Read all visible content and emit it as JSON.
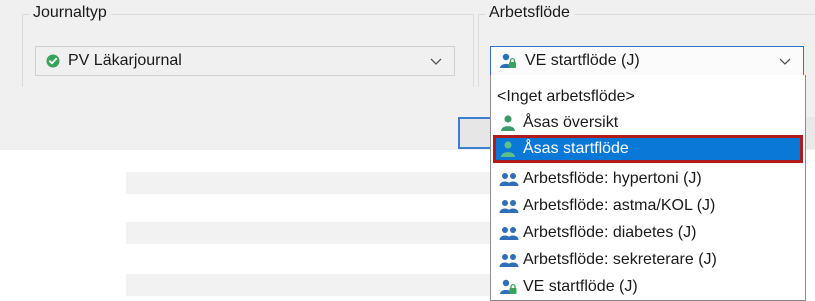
{
  "journaltyp": {
    "label": "Journaltyp",
    "value": "PV Läkarjournal",
    "icon": "check-circle-icon"
  },
  "arbetsflode": {
    "label": "Arbetsflöde",
    "value": "VE startflöde (J)",
    "icon": "user-lock-icon"
  },
  "dropdown": {
    "items": [
      {
        "label": "<Inget arbetsflöde>",
        "icon": ""
      },
      {
        "label": "Åsas översikt",
        "icon": "user-icon"
      },
      {
        "label": "Åsas startflöde",
        "icon": "user-icon",
        "selected": true
      },
      {
        "label": "Arbetsflöde: hypertoni (J)",
        "icon": "users-icon"
      },
      {
        "label": "Arbetsflöde: astma/KOL (J)",
        "icon": "users-icon"
      },
      {
        "label": "Arbetsflöde: diabetes (J)",
        "icon": "users-icon"
      },
      {
        "label": "Arbetsflöde: sekreterare (J)",
        "icon": "users-icon"
      },
      {
        "label": "VE startflöde (J)",
        "icon": "user-lock-icon"
      }
    ]
  },
  "colors": {
    "selection": "#0a78d7",
    "focus_border": "#b11b1b",
    "check_green": "#3aa35b",
    "user_green": "#3f9a6b",
    "group_blue": "#2f6fb7"
  }
}
